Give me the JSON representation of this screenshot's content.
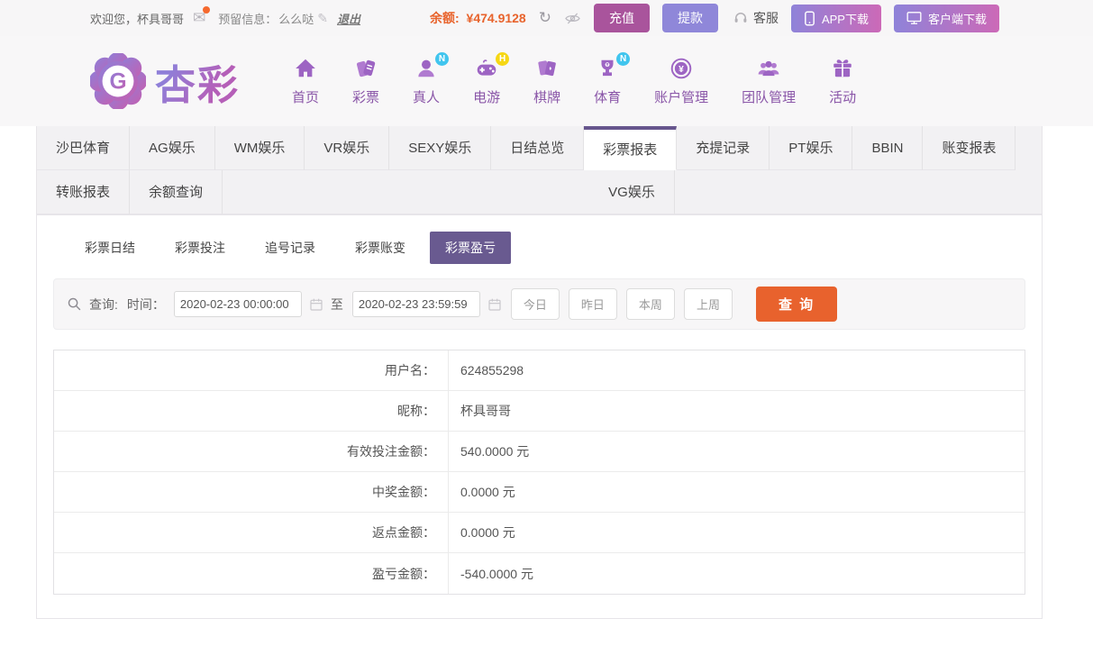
{
  "topbar": {
    "welcome": "欢迎您，杯具哥哥",
    "reserved_label": "预留信息：",
    "reserved_value": "么么哒",
    "logout": "退出",
    "balance_label": "余额:",
    "balance_value": "¥474.9128",
    "recharge": "充值",
    "withdraw": "提款",
    "service": "客服",
    "app_download": "APP下载",
    "client_download": "客户端下载",
    "mail_glyph": "✉",
    "edit_glyph": "✎",
    "refresh_glyph": "↻"
  },
  "header": {
    "logo_text": "杏彩",
    "logo_letter": "G",
    "nav": [
      {
        "label": "首页"
      },
      {
        "label": "彩票"
      },
      {
        "label": "真人",
        "badge": "N"
      },
      {
        "label": "电游",
        "badge": "H"
      },
      {
        "label": "棋牌"
      },
      {
        "label": "体育",
        "badge": "N"
      },
      {
        "label": "账户管理"
      },
      {
        "label": "团队管理"
      },
      {
        "label": "活动"
      }
    ]
  },
  "tabs": {
    "row1": [
      "沙巴体育",
      "AG娱乐",
      "WM娱乐",
      "VR娱乐",
      "SEXY娱乐",
      "日结总览",
      "彩票报表",
      "充提记录",
      "PT娱乐",
      "BBIN",
      "账变报表",
      "转账报表",
      "余额查询"
    ],
    "row2": [
      "VG娱乐"
    ],
    "active": "彩票报表"
  },
  "subtabs": {
    "items": [
      "彩票日结",
      "彩票投注",
      "追号记录",
      "彩票账变",
      "彩票盈亏"
    ],
    "active": "彩票盈亏"
  },
  "query": {
    "label": "查询:",
    "time_label": "时间：",
    "start_time": "2020-02-23 00:00:00",
    "to_label": "至",
    "end_time": "2020-02-23 23:59:59",
    "quick_buttons": [
      "今日",
      "昨日",
      "本周",
      "上周"
    ],
    "search_button": "查 询"
  },
  "report": {
    "rows": [
      {
        "label": "用户名：",
        "value": "624855298"
      },
      {
        "label": "昵称：",
        "value": "杯具哥哥"
      },
      {
        "label": "有效投注金额：",
        "value": "540.0000 元"
      },
      {
        "label": "中奖金额：",
        "value": "0.0000 元"
      },
      {
        "label": "返点金额：",
        "value": "0.0000 元"
      },
      {
        "label": "盈亏金额：",
        "value": "-540.0000 元"
      }
    ]
  },
  "colors": {
    "accent_purple": "#67568e",
    "subtab_active": "#695a90",
    "orange": "#e8622d",
    "recharge": "#a9549c",
    "withdraw": "#8f87d9",
    "nav_purple": "#8a56a8",
    "badge_blue": "#41c5ee",
    "badge_yellow": "#f6d714",
    "gradient_start": "#8f83d9",
    "gradient_end": "#cc69b7"
  }
}
